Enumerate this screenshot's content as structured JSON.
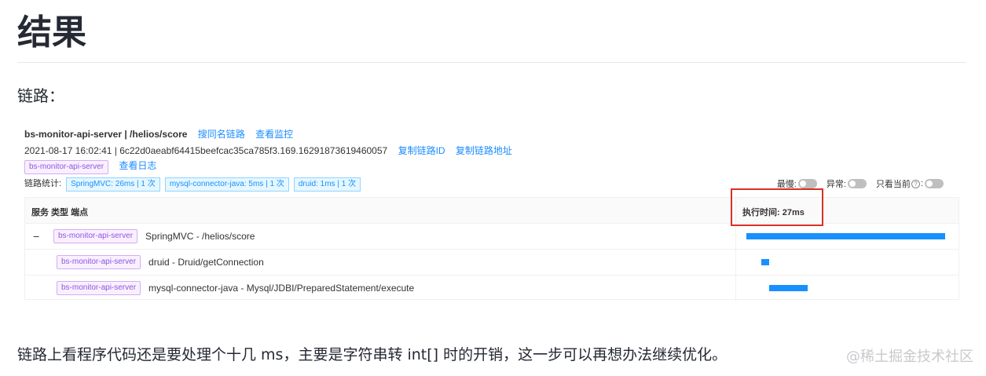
{
  "article": {
    "heading": "结果",
    "label": "链路：",
    "description": "链路上看程序代码还是要处理个十几 ms，主要是字符串转 int[] 时的开销，这一步可以再想办法继续优化。",
    "watermark": "@稀土掘金技术社区"
  },
  "trace": {
    "title": "bs-monitor-api-server | /helios/score",
    "search_link": "搜同名链路",
    "monitor_link": "查看监控",
    "meta": "2021-08-17 16:02:41 | 6c22d0aeabf64415beefcac35ca785f3.169.16291873619460057",
    "copy_id_link": "复制链路ID",
    "copy_url_link": "复制链路地址",
    "service_tag": "bs-monitor-api-server",
    "log_link": "查看日志",
    "stats_label": "链路统计:",
    "stats": [
      "SpringMVC: 26ms | 1 次",
      "mysql-connector-java: 5ms | 1 次",
      "druid: 1ms | 1 次"
    ],
    "toggles": {
      "slowest": "最慢:",
      "error": "异常:",
      "current_only": "只看当前",
      "help": "?",
      "colon": ":"
    },
    "table": {
      "header_left": "服务 类型 端点",
      "header_right": "执行时间:  27ms",
      "rows": [
        {
          "expand": "−",
          "service": "bs-monitor-api-server",
          "endpoint": "SpringMVC - /helios/score",
          "start_frac": 0.0,
          "dur_frac": 1.0
        },
        {
          "service": "bs-monitor-api-server",
          "endpoint": "druid - Druid/getConnection",
          "start_frac": 0.077,
          "dur_frac": 0.037
        },
        {
          "service": "bs-monitor-api-server",
          "endpoint": "mysql-connector-java - Mysql/JDBI/PreparedStatement/execute",
          "start_frac": 0.115,
          "dur_frac": 0.192
        }
      ]
    }
  },
  "colors": {
    "accent": "#1890ff",
    "highlight": "#d93025",
    "tag": "#9254de"
  }
}
